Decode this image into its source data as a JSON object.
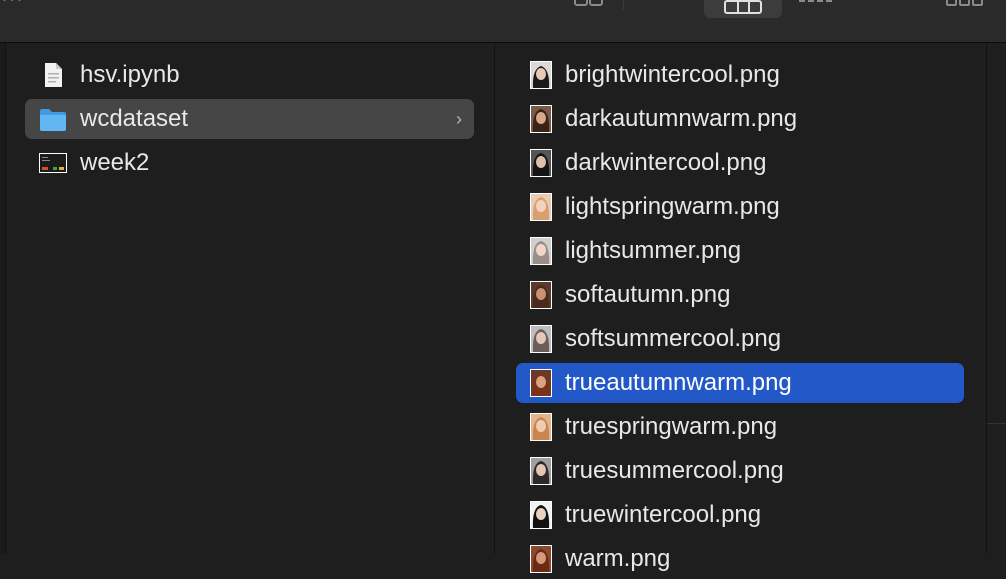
{
  "window": {
    "title_partial": "…"
  },
  "toolbar": {
    "view_icons": [
      "icon-view-icon",
      "list-view-icon",
      "column-view-icon",
      "gallery-view-icon",
      "group-icon"
    ],
    "active_view": "columns"
  },
  "colors": {
    "background": "#1e1e1e",
    "toolbar": "#2a2a2a",
    "selection_active": "#2358c9",
    "selection_inactive": "#464646"
  },
  "column1": {
    "items": [
      {
        "label": "hsv.ipynb",
        "icon": "document-icon",
        "selected": false,
        "kind": "file"
      },
      {
        "label": "wcdataset",
        "icon": "folder-icon",
        "selected": true,
        "kind": "folder"
      },
      {
        "label": "week2",
        "icon": "image-thumbnail-icon",
        "selected": false,
        "kind": "file"
      }
    ]
  },
  "column2": {
    "items": [
      {
        "label": "brightwintercool.png",
        "icon": "portrait-thumbnail-icon",
        "selected": false
      },
      {
        "label": "darkautumnwarm.png",
        "icon": "portrait-thumbnail-icon",
        "selected": false
      },
      {
        "label": "darkwintercool.png",
        "icon": "portrait-thumbnail-icon",
        "selected": false
      },
      {
        "label": "lightspringwarm.png",
        "icon": "portrait-thumbnail-icon",
        "selected": false
      },
      {
        "label": "lightsummer.png",
        "icon": "portrait-thumbnail-icon",
        "selected": false
      },
      {
        "label": "softautumn.png",
        "icon": "portrait-thumbnail-icon",
        "selected": false
      },
      {
        "label": "softsummercool.png",
        "icon": "portrait-thumbnail-icon",
        "selected": false
      },
      {
        "label": "trueautumnwarm.png",
        "icon": "portrait-thumbnail-icon",
        "selected": true
      },
      {
        "label": "truespringwarm.png",
        "icon": "portrait-thumbnail-icon",
        "selected": false
      },
      {
        "label": "truesummercool.png",
        "icon": "portrait-thumbnail-icon",
        "selected": false
      },
      {
        "label": "truewintercool.png",
        "icon": "portrait-thumbnail-icon",
        "selected": false
      },
      {
        "label": "warm.png",
        "icon": "portrait-thumbnail-icon",
        "selected": false
      }
    ]
  }
}
